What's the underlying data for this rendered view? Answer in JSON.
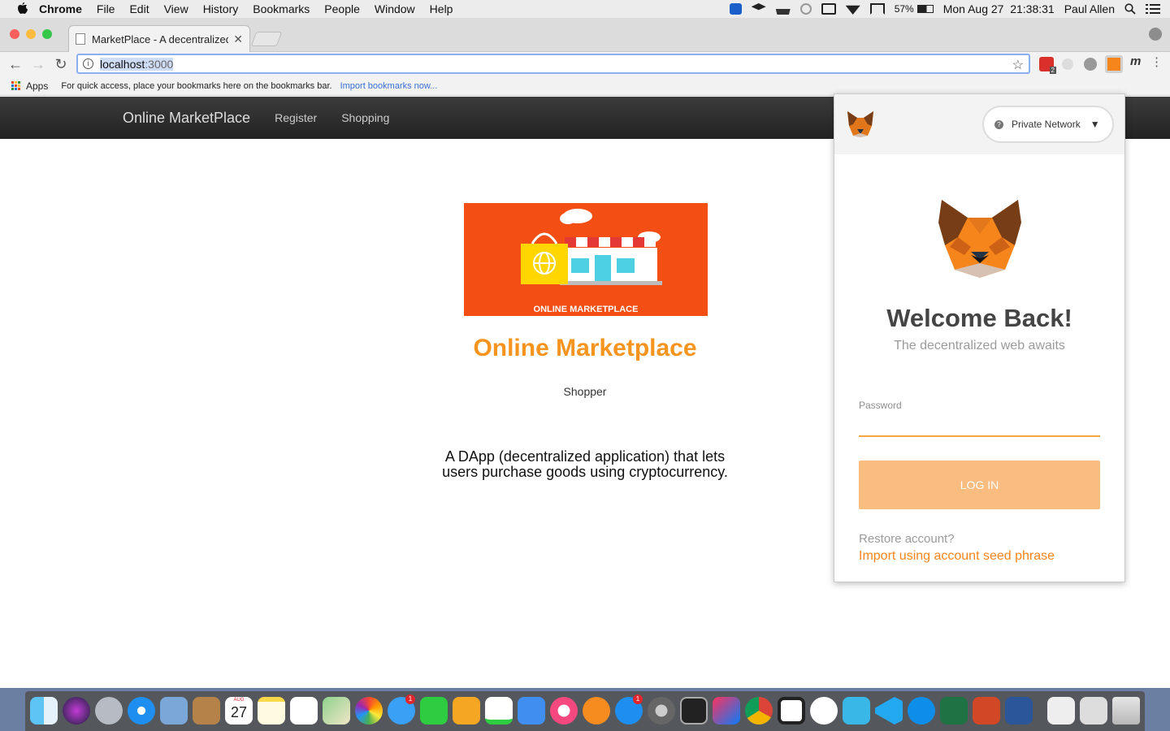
{
  "menubar": {
    "app": "Chrome",
    "menus": [
      "File",
      "Edit",
      "View",
      "History",
      "Bookmarks",
      "People",
      "Window",
      "Help"
    ],
    "battery": "57%",
    "clock": "Mon Aug 27  21:38:31",
    "user": "Paul Allen"
  },
  "browser": {
    "tab_title": "MarketPlace - A decentralized",
    "url_host": "localhost",
    "url_port": ":3000",
    "ext_badge": "2",
    "ext_m_label": "m",
    "bookmarks_apps": "Apps",
    "bookmarks_hint": "For quick access, place your bookmarks here on the bookmarks bar.",
    "bookmarks_import": "Import bookmarks now..."
  },
  "site": {
    "brand": "Online MarketPlace",
    "nav": [
      "Register",
      "Shopping"
    ],
    "hero_caption": "ONLINE MARKETPLACE",
    "title": "Online Marketplace",
    "subtitle": "Shopper",
    "desc_line1": "A DApp (decentralized application) that lets",
    "desc_line2": "users purchase goods using cryptocurrency."
  },
  "metamask": {
    "network": "Private Network",
    "welcome": "Welcome Back!",
    "tagline": "The decentralized web awaits",
    "password_label": "Password",
    "login_label": "LOG IN",
    "restore": "Restore account?",
    "import": "Import using account seed phrase"
  },
  "dock": {
    "calendar_month": "AUG",
    "calendar_day": "27",
    "badges": [
      "1",
      "1"
    ]
  },
  "colors": {
    "accent_orange": "#f7941d",
    "metamask_orange": "#f6851b",
    "login_button": "#fbbc7f",
    "hero_bg": "#f34e14",
    "nav_bg": "#2b2b2b"
  }
}
